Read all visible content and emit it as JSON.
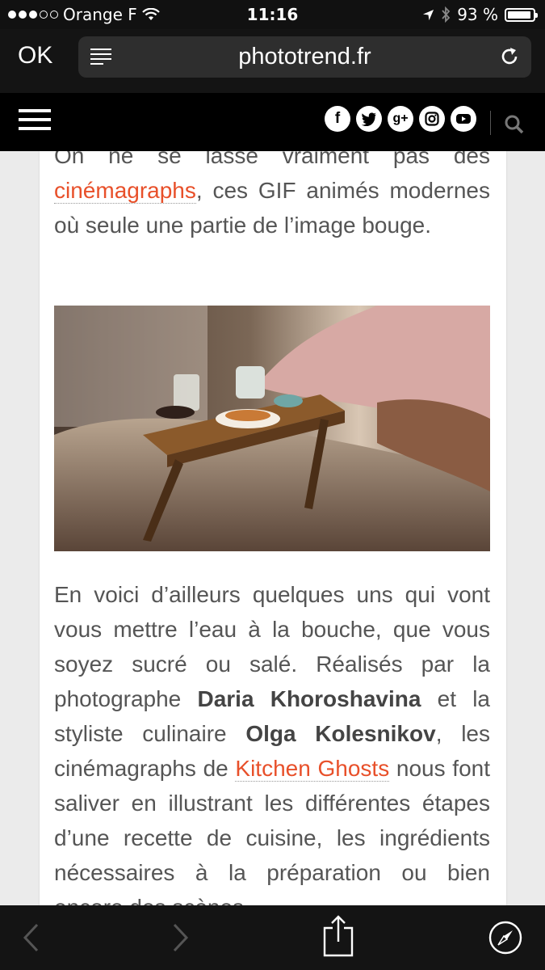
{
  "status_bar": {
    "carrier": "Orange F",
    "time": "11:16",
    "battery": "93 %",
    "signal_bars_filled": 3,
    "signal_bars_total": 5,
    "battery_level": 0.93
  },
  "browser": {
    "done_label": "OK",
    "url": "phototrend.fr"
  },
  "site_header": {
    "social_icons": [
      "facebook-icon",
      "twitter-icon",
      "google-plus-icon",
      "instagram-icon",
      "youtube-icon"
    ],
    "social_glyphs": [
      "f",
      "",
      "g+",
      "",
      ""
    ]
  },
  "article": {
    "p1": {
      "line0": "On ne se lasse vraiment pas des",
      "link": "cinémagraphs",
      "rest": ", ces GIF animés modernes où seule une partie de l’image bouge."
    },
    "p2": {
      "t1": "En voici d’ailleurs quelques uns qui vont vous mettre l’eau à la bouche, que vous soyez sucré ou salé. Réalisés par la photographe ",
      "b1": "Daria Khoroshavina",
      "t2": " et la styliste culinaire ",
      "b2": "Olga Kolesnikov",
      "t3": ", les cinémagraphs de ",
      "link": "Kitchen Ghosts",
      "t4": " nous font saliver en illustrant les différentes étapes d’une recette de cuisine, les ingrédients nécessaires à la préparation ou bien encore des scènes"
    }
  },
  "colors": {
    "link": "#e8502a",
    "bar_bg": "#141414",
    "header_bg": "#000000",
    "page_bg": "#ebebeb"
  }
}
